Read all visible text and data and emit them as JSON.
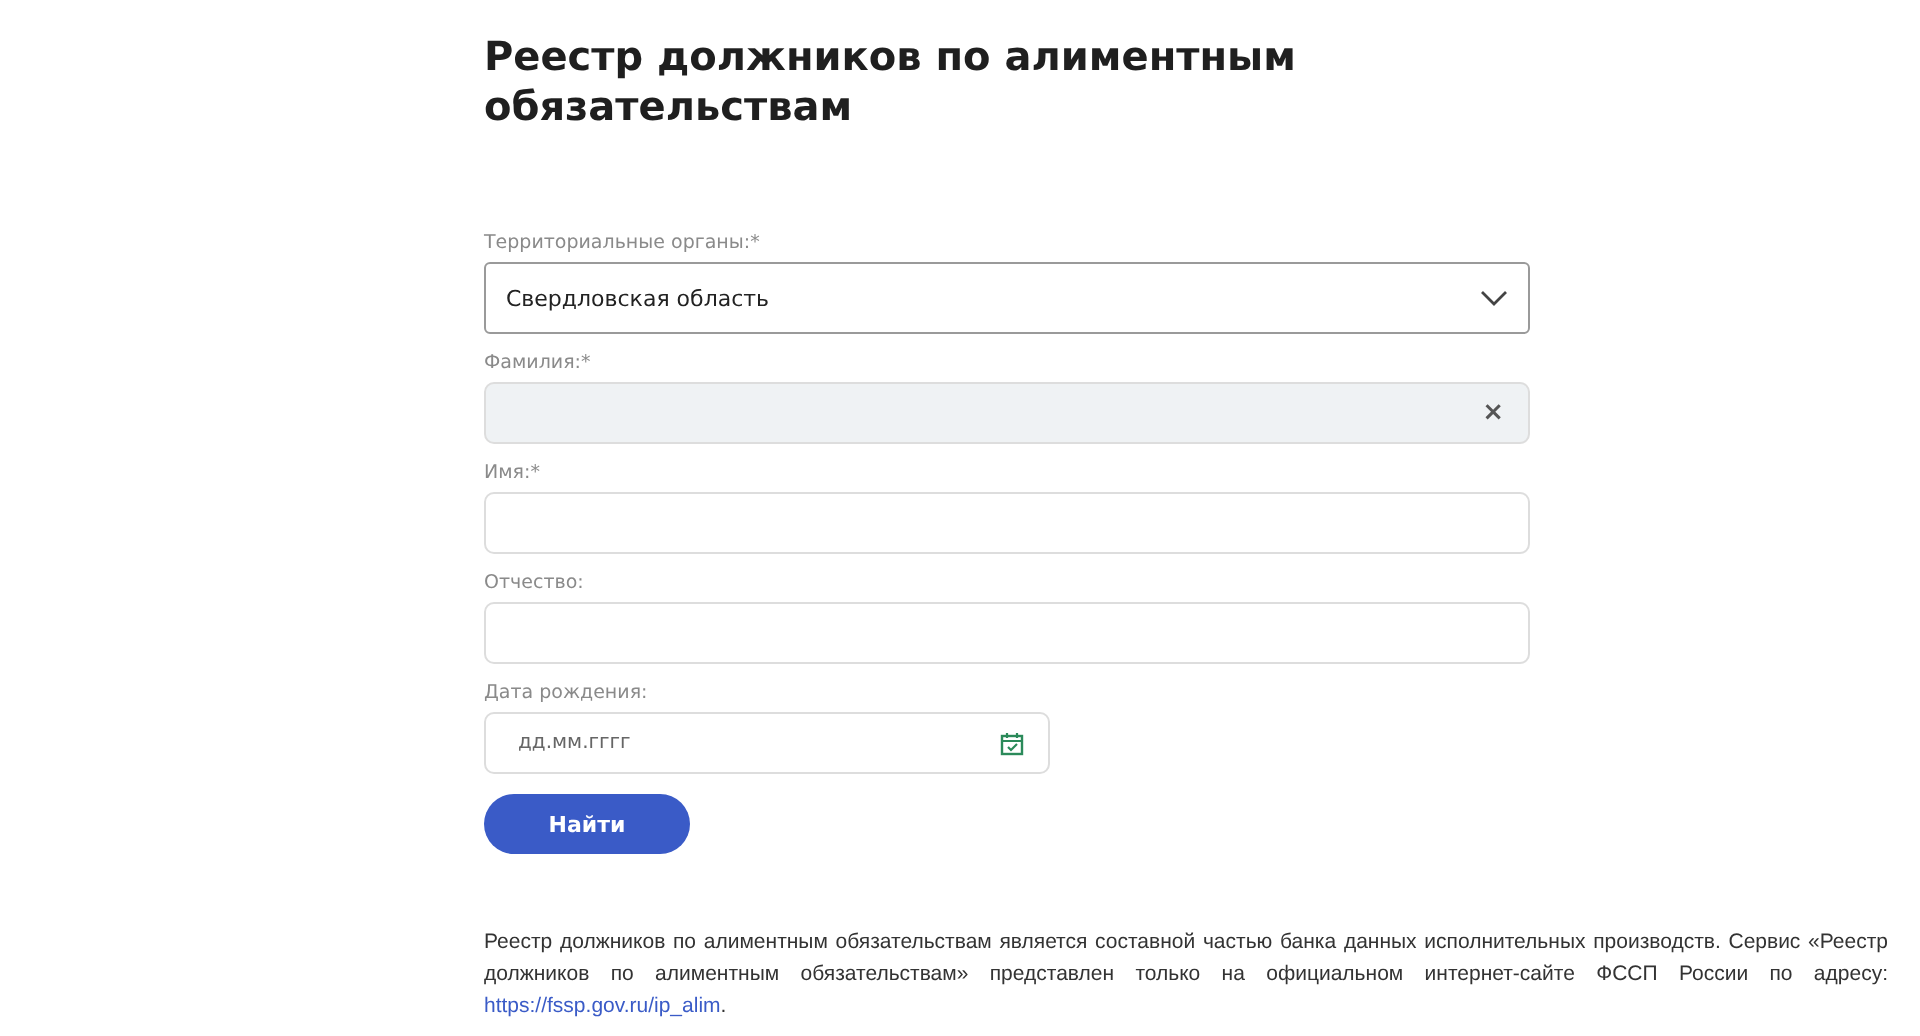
{
  "title": "Реестр должников по алиментным обязательствам",
  "fields": [
    {
      "kind": "select",
      "label": "Территориальные органы:*",
      "value": "Свердловская область"
    },
    {
      "kind": "text",
      "label": "Фамилия:*",
      "filled": true,
      "clear": "×"
    },
    {
      "kind": "text",
      "label": "Имя:*",
      "filled": false
    },
    {
      "kind": "text",
      "label": "Отчество:",
      "filled": false
    },
    {
      "kind": "date",
      "label": "Дата рождения:",
      "placeholder": "дд.мм.гггг"
    }
  ],
  "submit": "Найти",
  "note": {
    "text": "Реестр должников по алиментным обязательствам является составной частью банка данных исполнительных производств. Сервис «Реестр должников по алиментным обязательствам» представлен только на официальном интернет-сайте ФССП России по адресу: ",
    "link": "https://fssp.gov.ru/ip_alim",
    "after": "."
  }
}
